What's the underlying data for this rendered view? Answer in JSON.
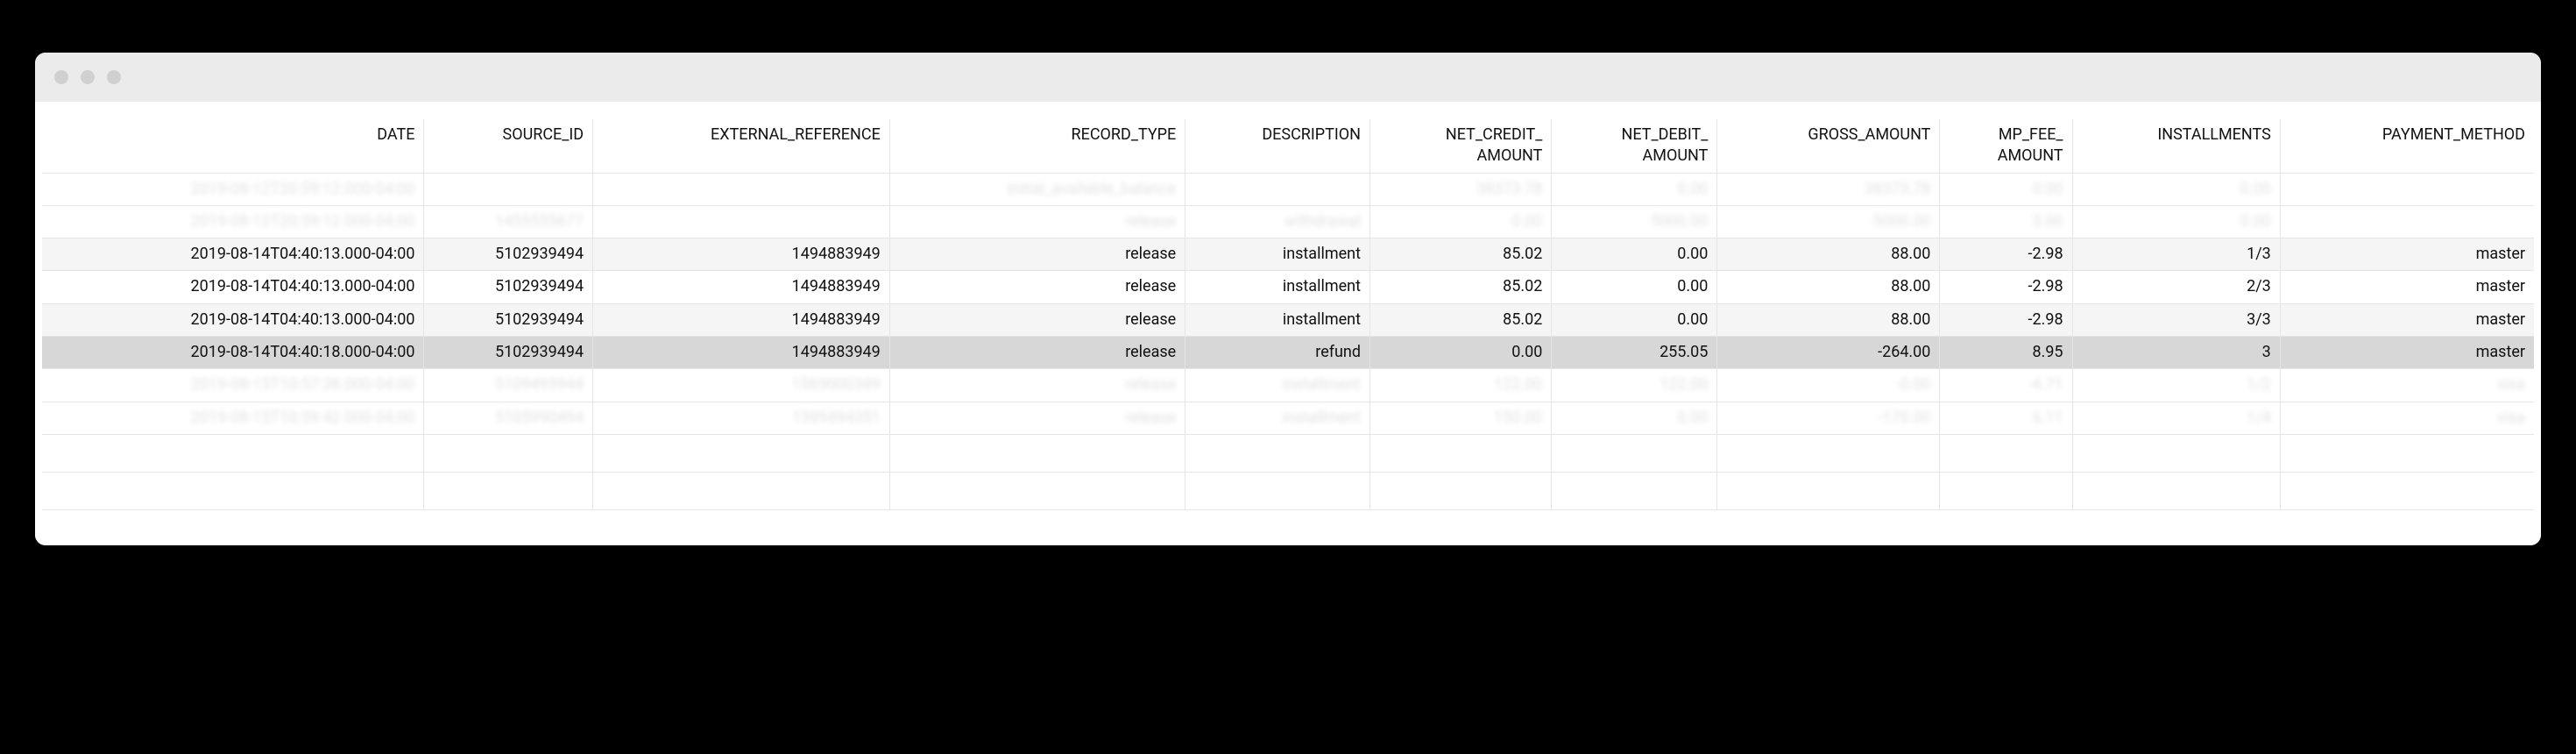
{
  "columns": [
    {
      "key": "date",
      "label": "DATE"
    },
    {
      "key": "source_id",
      "label": "SOURCE_ID"
    },
    {
      "key": "external_reference",
      "label": "EXTERNAL_REFERENCE"
    },
    {
      "key": "record_type",
      "label": "RECORD_TYPE"
    },
    {
      "key": "description",
      "label": "DESCRIPTION"
    },
    {
      "key": "net_credit_amount",
      "label": "NET_CREDIT_\nAMOUNT"
    },
    {
      "key": "net_debit_amount",
      "label": "NET_DEBIT_\nAMOUNT"
    },
    {
      "key": "gross_amount",
      "label": "GROSS_AMOUNT"
    },
    {
      "key": "mp_fee_amount",
      "label": "MP_FEE_\nAMOUNT"
    },
    {
      "key": "installments",
      "label": "INSTALLMENTS"
    },
    {
      "key": "payment_method",
      "label": "PAYMENT_METHOD"
    }
  ],
  "rows": [
    {
      "style": "blur",
      "cells": [
        "2019-08-12T20:59:12.000-04:00",
        "",
        "",
        "initial_available_balance",
        "",
        "38373.78",
        "0.00",
        "38373.78",
        "0.00",
        "0.00",
        ""
      ]
    },
    {
      "style": "blur",
      "cells": [
        "2019-08-12T20:59:12.000-04:00",
        "1455555677",
        "",
        "release",
        "withdrawal",
        "0.00",
        "5000.00",
        "-5000.00",
        "3.00",
        "0.00",
        ""
      ]
    },
    {
      "style": "clear",
      "cells": [
        "2019-08-14T04:40:13.000-04:00",
        "5102939494",
        "1494883949",
        "release",
        "installment",
        "85.02",
        "0.00",
        "88.00",
        "-2.98",
        "1/3",
        "master"
      ]
    },
    {
      "style": "clear alt",
      "cells": [
        "2019-08-14T04:40:13.000-04:00",
        "5102939494",
        "1494883949",
        "release",
        "installment",
        "85.02",
        "0.00",
        "88.00",
        "-2.98",
        "2/3",
        "master"
      ]
    },
    {
      "style": "clear",
      "cells": [
        "2019-08-14T04:40:13.000-04:00",
        "5102939494",
        "1494883949",
        "release",
        "installment",
        "85.02",
        "0.00",
        "88.00",
        "-2.98",
        "3/3",
        "master"
      ]
    },
    {
      "style": "highlight",
      "cells": [
        "2019-08-14T04:40:18.000-04:00",
        "5102939494",
        "1494883949",
        "release",
        "refund",
        "0.00",
        "255.05",
        "-264.00",
        "8.95",
        "3",
        "master"
      ]
    },
    {
      "style": "blur",
      "cells": [
        "2019-08-15T10:57:38.000-04:00",
        "5109493944",
        "1569000349",
        "release",
        "installment",
        "122.00",
        "122.00",
        "-0.00",
        "-4.71",
        "1/2",
        "visa"
      ]
    },
    {
      "style": "blur",
      "cells": [
        "2019-08-15T10:59:42.000-04:00",
        "5105990494",
        "1599494351",
        "release",
        "installment",
        "150.00",
        "0.00",
        "-170.00",
        "6.11",
        "1/4",
        "visa"
      ]
    },
    {
      "style": "blank",
      "cells": [
        "",
        "",
        "",
        "",
        "",
        "",
        "",
        "",
        "",
        "",
        ""
      ]
    },
    {
      "style": "blank",
      "cells": [
        "",
        "",
        "",
        "",
        "",
        "",
        "",
        "",
        "",
        "",
        ""
      ]
    }
  ]
}
